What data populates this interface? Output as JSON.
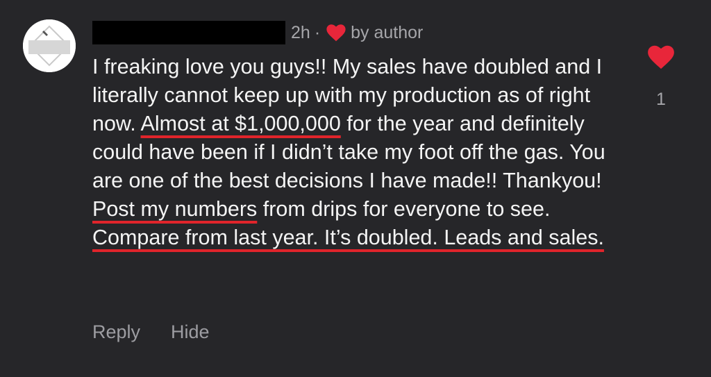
{
  "comment": {
    "time": "2h",
    "separator": "·",
    "author_badge": "by author",
    "author_heart_icon": "heart-icon",
    "colors": {
      "background": "#262629",
      "heart": "#e8263a",
      "underline": "#e0242b"
    },
    "text": {
      "p1": "I freaking love you guys!! My sales have doubled and I literally cannot keep up with my production as of right now. ",
      "h1": "Almost at $1,000,000",
      "p2": " for the year and definitely could have been if I didn’t take my foot off the gas. You are one of the best decisions I have made!! Thankyou! ",
      "h2": "Post my numbers",
      "p3": " from drips for everyone to see. ",
      "h3": "Compare from last year. It’s doubled. Leads and sales."
    },
    "actions": {
      "reply": "Reply",
      "hide": "Hide"
    },
    "like": {
      "icon": "heart-icon",
      "count": "1",
      "liked": true
    }
  }
}
